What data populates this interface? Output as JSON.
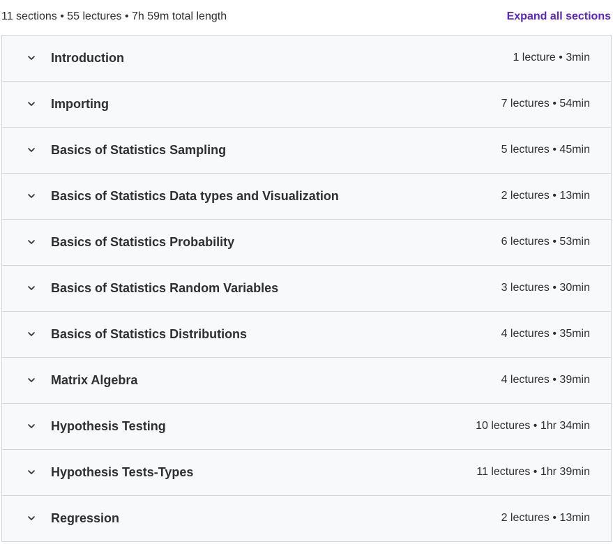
{
  "header": {
    "summary": "11 sections • 55 lectures • 7h 59m total length",
    "expand_label": "Expand all sections"
  },
  "accent_color": "#5624d0",
  "icons": {
    "section_toggle": "chevron-down-icon"
  },
  "sections": [
    {
      "title": "Introduction",
      "meta": "1 lecture • 3min"
    },
    {
      "title": "Importing",
      "meta": "7 lectures • 54min"
    },
    {
      "title": "Basics of Statistics Sampling",
      "meta": "5 lectures • 45min"
    },
    {
      "title": "Basics of Statistics Data types and Visualization",
      "meta": "2 lectures • 13min"
    },
    {
      "title": "Basics of Statistics Probability",
      "meta": "6 lectures • 53min"
    },
    {
      "title": "Basics of Statistics Random Variables",
      "meta": "3 lectures • 30min"
    },
    {
      "title": "Basics of Statistics Distributions",
      "meta": "4 lectures • 35min"
    },
    {
      "title": "Matrix Algebra",
      "meta": "4 lectures • 39min"
    },
    {
      "title": "Hypothesis Testing",
      "meta": "10 lectures • 1hr 34min"
    },
    {
      "title": "Hypothesis Tests-Types",
      "meta": "11 lectures • 1hr 39min"
    },
    {
      "title": "Regression",
      "meta": "2 lectures • 13min"
    }
  ]
}
